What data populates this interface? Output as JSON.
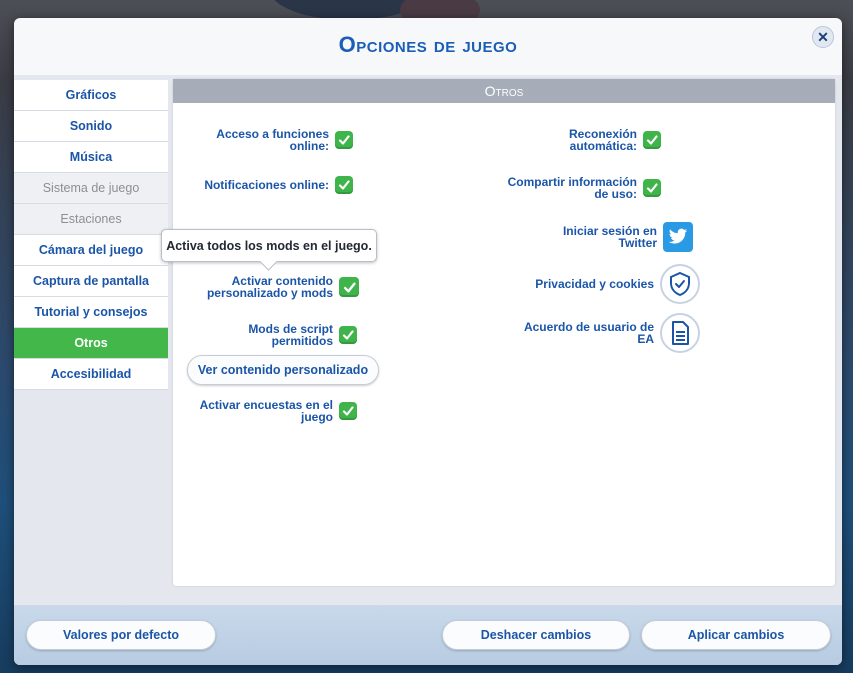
{
  "dialog": {
    "title": "Opciones de juego",
    "close_icon": "close-icon"
  },
  "sidebar": {
    "items": [
      {
        "label": "Gráficos",
        "state": "enabled"
      },
      {
        "label": "Sonido",
        "state": "enabled"
      },
      {
        "label": "Música",
        "state": "enabled"
      },
      {
        "label": "Sistema de juego",
        "state": "disabled"
      },
      {
        "label": "Estaciones",
        "state": "disabled"
      },
      {
        "label": "Cámara del juego",
        "state": "enabled"
      },
      {
        "label": "Captura de pantalla",
        "state": "enabled"
      },
      {
        "label": "Tutorial y consejos",
        "state": "enabled"
      },
      {
        "label": "Otros",
        "state": "active"
      },
      {
        "label": "Accesibilidad",
        "state": "enabled"
      }
    ]
  },
  "panel": {
    "header": "Otros",
    "left": {
      "online_functions": "Acceso a funciones online:",
      "online_notifications": "Notificaciones online:",
      "custom_content": "Activar contenido personalizado y mods",
      "script_mods": "Mods de script permitidos",
      "view_custom_content": "Ver contenido personalizado",
      "surveys": "Activar encuestas en el juego"
    },
    "right": {
      "auto_reconnect": "Reconexión automática:",
      "share_usage": "Compartir información de uso:",
      "twitter_login": "Iniciar sesión en Twitter",
      "privacy": "Privacidad y cookies",
      "user_agreement": "Acuerdo de usuario de EA"
    },
    "checkboxes": {
      "online_functions": true,
      "online_notifications": true,
      "custom_content": true,
      "script_mods": true,
      "surveys": true,
      "auto_reconnect": true,
      "share_usage": true
    },
    "tooltip": "Activa todos los mods en el juego."
  },
  "footer": {
    "defaults": "Valores por defecto",
    "undo": "Deshacer cambios",
    "apply": "Aplicar cambios"
  },
  "colors": {
    "title_blue": "#1a5eb8",
    "label_blue": "#1b55a8",
    "active_green": "#44b74a",
    "check_green": "#3fb44a",
    "header_gray": "#a6adb8"
  }
}
